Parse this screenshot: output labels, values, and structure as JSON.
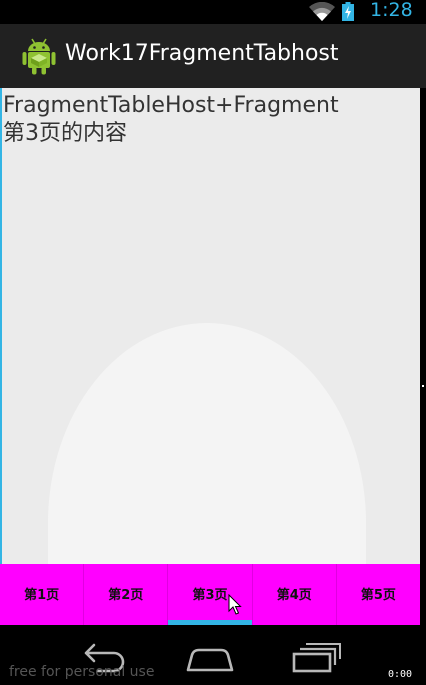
{
  "status_bar": {
    "time": "1:28",
    "icons": [
      "wifi-icon",
      "battery-charging-icon"
    ],
    "accent_color": "#33b5e5"
  },
  "action_bar": {
    "title": "Work17FragmentTabhost",
    "icon": "android-robot-icon",
    "background_color": "#212121"
  },
  "content": {
    "text": "FragmentTableHost+Fragment\n第3页的内容",
    "background_color": "#ebebeb"
  },
  "tabs": {
    "items": [
      {
        "label": "第1页"
      },
      {
        "label": "第2页"
      },
      {
        "label": "第3页"
      },
      {
        "label": "第4页"
      },
      {
        "label": "第5页"
      }
    ],
    "selected_index": 2,
    "background_color": "#ff00ff",
    "indicator_color": "#33b5e5"
  },
  "nav_bar": {
    "buttons": [
      "back-icon",
      "home-icon",
      "recents-icon"
    ],
    "watermark": "free for personal use",
    "cursor_coords": "0:00"
  }
}
